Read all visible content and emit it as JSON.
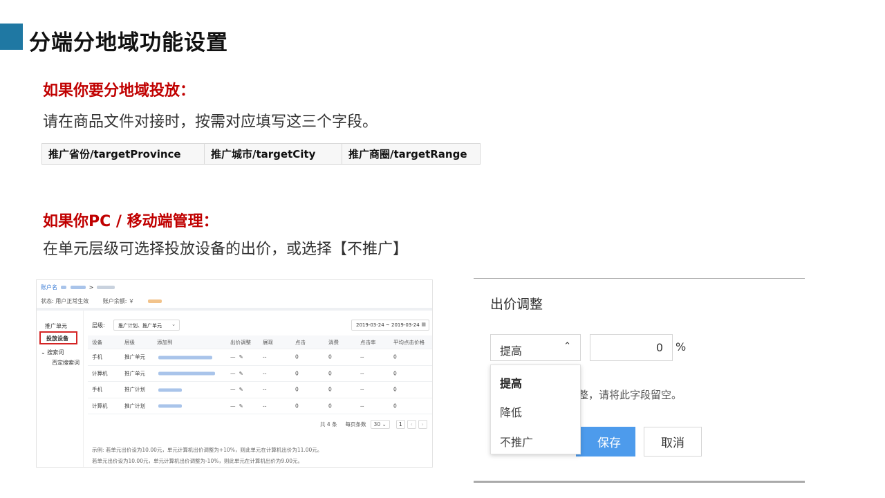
{
  "slide": {
    "title": "分端分地域功能设置",
    "section1": {
      "heading": "如果你要分地域投放：",
      "text": "请在商品文件对接时，按需对应填写这三个字段。",
      "fields": [
        "推广省份/targetProvince",
        "推广城市/targetCity",
        "推广商圈/targetRange"
      ]
    },
    "section2": {
      "heading": "如果你PC / 移动端管理：",
      "text": "在单元层级可选择投放设备的出价，或选择【不推广】"
    }
  },
  "console": {
    "breadcrumb_root": "账户名",
    "breadcrumb_sep": ">",
    "status_label": "状态: 用户正常生效",
    "balance_label": "账户余额: ￥",
    "sidebar": {
      "unit": "推广单元",
      "device": "投放设备",
      "keywords": "搜索词",
      "negative": "否定搜索词",
      "expand_icon": "⌄"
    },
    "filter_label": "层级:",
    "filter_value": "推广计划、推广单元",
    "date_range": "2019-03-24 ~ 2019-03-24",
    "columns": [
      "设备",
      "层级",
      "添加到",
      "出价调整",
      "展现",
      "点击",
      "消费",
      "点击率",
      "平均点击价格"
    ],
    "rows": [
      {
        "device": "手机",
        "level": "推广单元",
        "bid": "—",
        "impressions": "--",
        "clicks": "0",
        "cost": "0",
        "ctr": "--",
        "cpc": "0"
      },
      {
        "device": "计算机",
        "level": "推广单元",
        "bid": "—",
        "impressions": "--",
        "clicks": "0",
        "cost": "0",
        "ctr": "--",
        "cpc": "0"
      },
      {
        "device": "手机",
        "level": "推广计划",
        "bid": "—",
        "impressions": "--",
        "clicks": "0",
        "cost": "0",
        "ctr": "--",
        "cpc": "0"
      },
      {
        "device": "计算机",
        "level": "推广计划",
        "bid": "—",
        "impressions": "--",
        "clicks": "0",
        "cost": "0",
        "ctr": "--",
        "cpc": "0"
      }
    ],
    "pager": {
      "total": "共 4 条",
      "per_page_label": "每页条数",
      "per_page": "30",
      "page": "1",
      "prev": "‹",
      "next": "›"
    },
    "note1": "示例: 若单元出价设为10.00元，单元计算机出价调整为+10%，则此单元在计算机出价为11.00元。",
    "note2": "若单元出价设为10.00元，单元计算机出价调整为-10%，则此单元在计算机出价为9.00元。"
  },
  "dialog": {
    "title": "出价调整",
    "select_value": "提高",
    "input_value": "0",
    "unit": "%",
    "hint": "整，请将此字段留空。",
    "options": [
      "提高",
      "降低",
      "不推广"
    ],
    "save_label": "保存",
    "cancel_label": "取消"
  },
  "colors": {
    "accent_block": "#1f78a3",
    "heading_red": "#c00000",
    "primary_button": "#4d9bec",
    "highlight_box": "#d42424",
    "link_blue": "#3a7bd5"
  },
  "icons": {
    "chevron_down": "⌄",
    "chevron_up": "⌃",
    "calendar": "▦",
    "edit": "✎"
  }
}
